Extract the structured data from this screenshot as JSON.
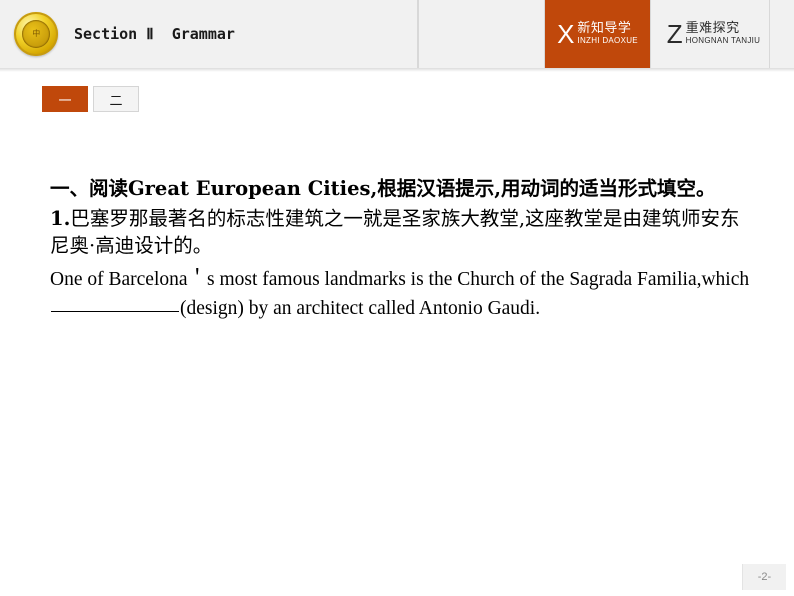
{
  "header": {
    "logo_icon": "gold-seal-logo-icon",
    "logo_mark_text": "中",
    "section_title": "Section Ⅱ  Grammar",
    "nav_buttons": [
      {
        "letter": "X",
        "cn": "新知导学",
        "en": "INZHI DAOXUE",
        "state": "active",
        "accent": "#c0480b"
      },
      {
        "letter": "Z",
        "cn": "重难探究",
        "en": "HONGNAN TANJIU",
        "state": "inactive",
        "accent": "#f1f1f1"
      }
    ]
  },
  "tabs": [
    {
      "label": "一",
      "state": "active"
    },
    {
      "label": "二",
      "state": "inactive"
    }
  ],
  "main": {
    "heading": "一、阅读Great European Cities,根据汉语提示,用动词的适当形式填空。",
    "item_number": "1.",
    "chinese_prompt": "巴塞罗那最著名的标志性建筑之一就是圣家族大教堂,这座教堂是由建筑师安东尼奥·高迪设计的。",
    "english_part_1": "One of Barcelona＇s most famous landmarks is the Church of the Sagrada Familia,which ",
    "english_part_2": "(design) by an architect called Antonio Gaudi."
  },
  "footer": {
    "page_number": "-2-"
  },
  "colors": {
    "accent_orange": "#c0480b",
    "header_bg": "#f1f1f1",
    "text": "#000000"
  }
}
